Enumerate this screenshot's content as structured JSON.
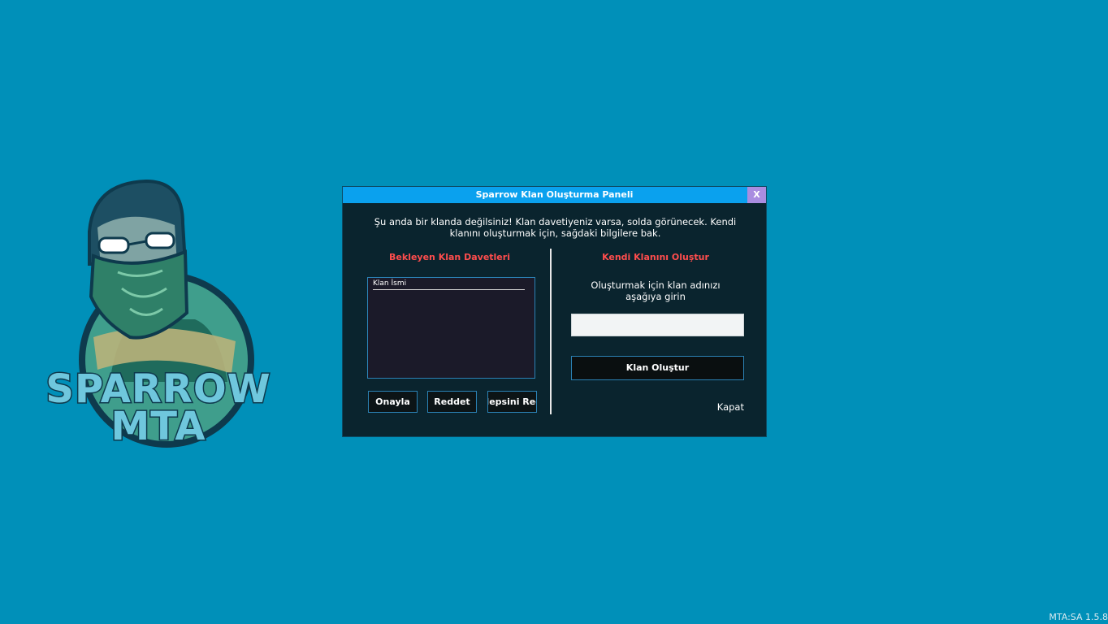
{
  "logo": {
    "line1": "SPARROW",
    "line2": "MTA"
  },
  "window": {
    "title": "Sparrow Klan Oluşturma Paneli",
    "close_x": "X",
    "info": "Şu anda bir klanda değilsiniz! Klan davetiyeniz varsa, solda görünecek. Kendi klanını oluşturmak için, sağdaki bilgilere bak."
  },
  "pending": {
    "title": "Bekleyen Klan Davetleri",
    "column_header": "Klan İsmi",
    "rows": [],
    "approve_label": "Onayla",
    "reject_label": "Reddet",
    "reject_all_label": "Hepsini Reddet"
  },
  "create": {
    "title": "Kendi Klanını Oluştur",
    "description": "Oluşturmak için klan adınızı aşağıya girin",
    "input_value": "",
    "button_label": "Klan Oluştur",
    "close_label": "Kapat"
  },
  "footer": {
    "version": "MTA:SA 1.5.8"
  },
  "colors": {
    "background": "#0090b9",
    "window_bg": "#0a242e",
    "titlebar": "#0aa1ee",
    "close_x_bg": "#a98de0",
    "section_title": "#ff4d4d",
    "list_bg": "#1b1a29",
    "button_border": "#2b82b5"
  }
}
